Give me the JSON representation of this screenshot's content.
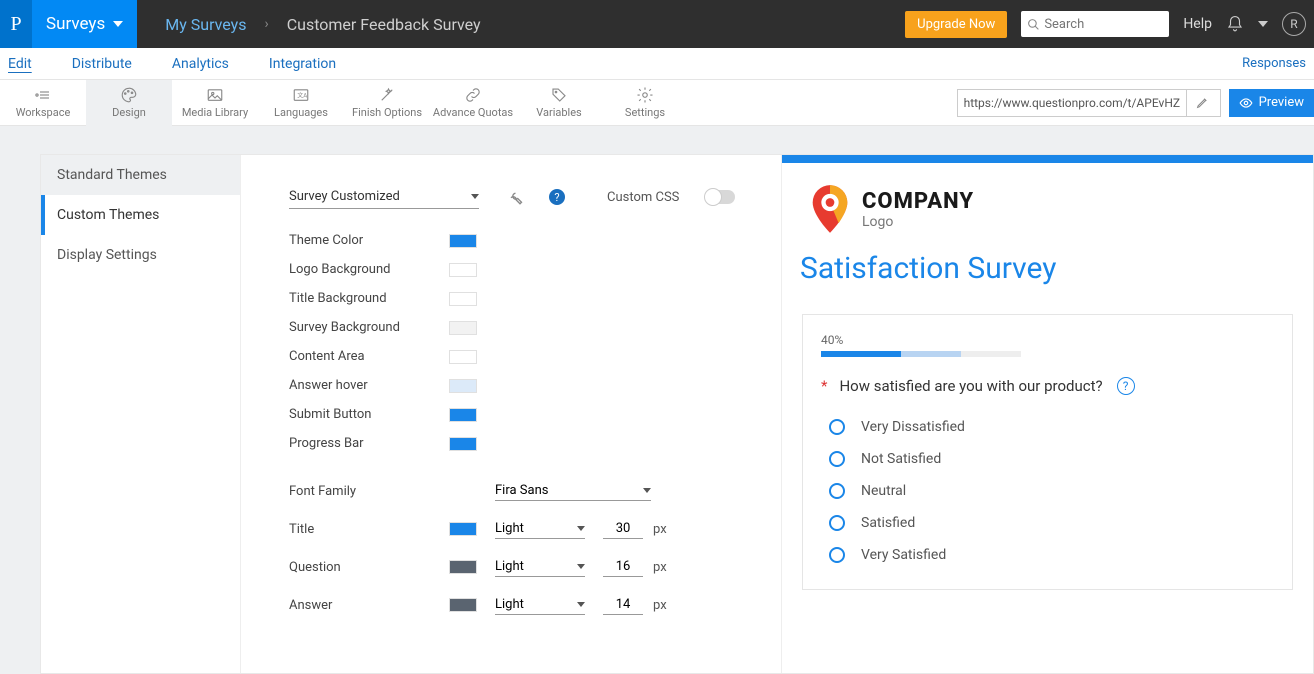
{
  "topbar": {
    "surveys_label": "Surveys",
    "my_surveys": "My Surveys",
    "current": "Customer Feedback Survey",
    "upgrade": "Upgrade Now",
    "search_placeholder": "Search",
    "help": "Help",
    "avatar_initial": "R"
  },
  "tabs": {
    "edit": "Edit",
    "distribute": "Distribute",
    "analytics": "Analytics",
    "integration": "Integration",
    "responses": "Responses"
  },
  "tools": {
    "workspace": "Workspace",
    "design": "Design",
    "media": "Media Library",
    "languages": "Languages",
    "finish": "Finish Options",
    "quotas": "Advance Quotas",
    "variables": "Variables",
    "settings": "Settings",
    "url": "https://www.questionpro.com/t/APEvHZeq",
    "preview": "Preview"
  },
  "theme_nav": {
    "standard": "Standard Themes",
    "custom": "Custom Themes",
    "display": "Display Settings"
  },
  "settings": {
    "dropdown": "Survey Customized",
    "custom_css": "Custom CSS",
    "theme_color": {
      "label": "Theme Color",
      "color": "#1a86e8"
    },
    "logo_bg": {
      "label": "Logo Background",
      "color": "#ffffff"
    },
    "title_bg": {
      "label": "Title Background",
      "color": "#ffffff"
    },
    "survey_bg": {
      "label": "Survey Background",
      "color": "#f2f2f2"
    },
    "content_area": {
      "label": "Content Area",
      "color": "#ffffff"
    },
    "answer_hover": {
      "label": "Answer hover",
      "color": "#dceaf9"
    },
    "submit_btn": {
      "label": "Submit Button",
      "color": "#1a86e8"
    },
    "progress_bar": {
      "label": "Progress Bar",
      "color": "#1a86e8"
    },
    "font_family": {
      "label": "Font Family",
      "value": "Fira Sans"
    },
    "title": {
      "label": "Title",
      "color": "#1a86e8",
      "weight": "Light",
      "size": "30",
      "unit": "px"
    },
    "question": {
      "label": "Question",
      "color": "#5a6470",
      "weight": "Light",
      "size": "16",
      "unit": "px"
    },
    "answer": {
      "label": "Answer",
      "color": "#5a6470",
      "weight": "Light",
      "size": "14",
      "unit": "px"
    }
  },
  "preview": {
    "company": "COMPANY",
    "logo_sub": "Logo",
    "title": "Satisfaction Survey",
    "progress": "40%",
    "question": "How satisfied are you with our product?",
    "options": [
      "Very Dissatisfied",
      "Not Satisfied",
      "Neutral",
      "Satisfied",
      "Very Satisfied"
    ]
  }
}
